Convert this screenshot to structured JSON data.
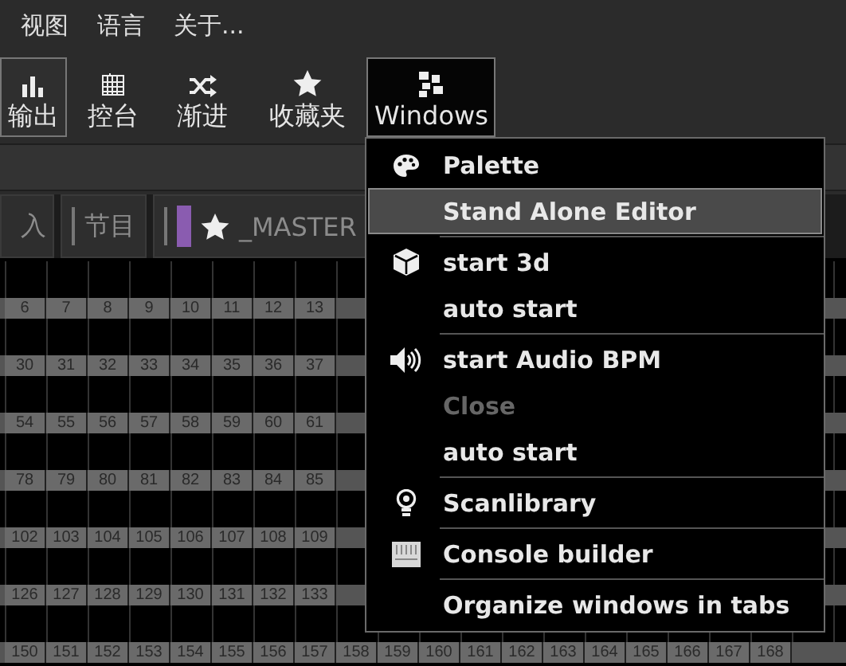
{
  "menubar": [
    {
      "label": "视图"
    },
    {
      "label": "语言"
    },
    {
      "label": "关于..."
    }
  ],
  "toolbar": [
    {
      "label": "输出",
      "selected": true,
      "open": false
    },
    {
      "label": "控台",
      "selected": false,
      "open": false
    },
    {
      "label": "渐进",
      "selected": false,
      "open": false
    },
    {
      "label": "收藏夹",
      "selected": false,
      "open": false
    },
    {
      "label": "Windows",
      "selected": true,
      "open": true
    }
  ],
  "tabs": [
    {
      "label": "入",
      "kind": "plain"
    },
    {
      "label": "节目",
      "kind": "plain"
    },
    {
      "label": "_MASTER",
      "kind": "favorite",
      "color": "#8a5cb0"
    }
  ],
  "grid": {
    "rows": [
      [
        "6",
        "7",
        "8",
        "9",
        "10",
        "11",
        "12",
        "13"
      ],
      [
        "30",
        "31",
        "32",
        "33",
        "34",
        "35",
        "36",
        "37"
      ],
      [
        "54",
        "55",
        "56",
        "57",
        "58",
        "59",
        "60",
        "61"
      ],
      [
        "78",
        "79",
        "80",
        "81",
        "82",
        "83",
        "84",
        "85"
      ],
      [
        "102",
        "103",
        "104",
        "105",
        "106",
        "107",
        "108",
        "109"
      ],
      [
        "126",
        "127",
        "128",
        "129",
        "130",
        "131",
        "132",
        "133"
      ],
      [
        "150",
        "151",
        "152",
        "153",
        "154",
        "155",
        "156",
        "157",
        "158",
        "159",
        "160",
        "161",
        "162",
        "163",
        "164",
        "165",
        "166",
        "167",
        "168"
      ]
    ]
  },
  "windows_menu": {
    "groups": [
      [
        {
          "label": "Palette",
          "selected": false,
          "disabled": false
        },
        {
          "label": "Stand Alone Editor",
          "selected": true,
          "disabled": false
        }
      ],
      [
        {
          "label": "start 3d",
          "selected": false,
          "disabled": false
        },
        {
          "label": "auto start",
          "selected": false,
          "disabled": false
        }
      ],
      [
        {
          "label": "start Audio BPM",
          "selected": false,
          "disabled": false
        },
        {
          "label": "Close",
          "selected": false,
          "disabled": true
        },
        {
          "label": "auto start",
          "selected": false,
          "disabled": false
        }
      ],
      [
        {
          "label": "Scanlibrary",
          "selected": false,
          "disabled": false
        }
      ],
      [
        {
          "label": "Console builder",
          "selected": false,
          "disabled": false
        }
      ],
      [
        {
          "label": "Organize windows in tabs",
          "selected": false,
          "disabled": false
        }
      ]
    ]
  }
}
